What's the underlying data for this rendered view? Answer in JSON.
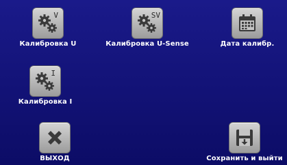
{
  "tiles": {
    "cal_u": {
      "label": "Калибровка U",
      "superscript": "V"
    },
    "cal_usense": {
      "label": "Калибровка U-Sense",
      "superscript": "SV"
    },
    "cal_date": {
      "label": "Дата калибр."
    },
    "cal_i": {
      "label": "Калибровка I",
      "superscript": "I"
    },
    "exit": {
      "label": "ВЫХОД"
    },
    "save_exit": {
      "label": "Сохранить и выйти"
    }
  },
  "colors": {
    "background": "#0f0f6e",
    "icon_face": "#c0c0c0",
    "icon_glyph": "#3a3a3a",
    "label_text": "#ffffff"
  },
  "icons": {
    "cal_u": "gears-icon",
    "cal_usense": "gears-icon",
    "cal_date": "calendar-icon",
    "cal_i": "gears-icon",
    "exit": "close-icon",
    "save_exit": "save-icon"
  }
}
